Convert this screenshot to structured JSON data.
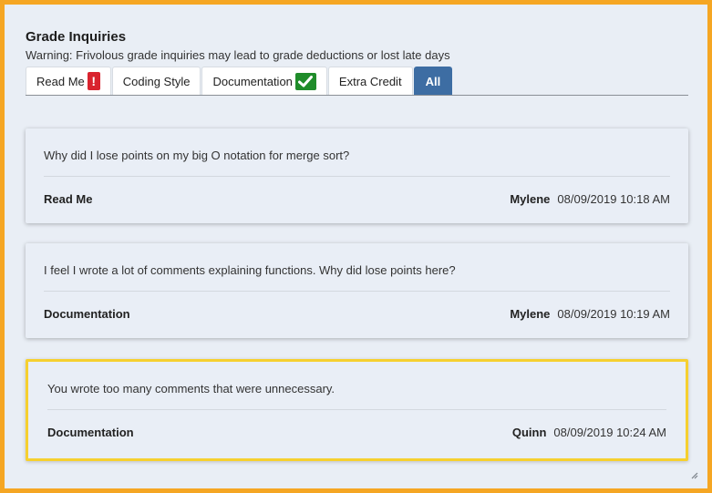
{
  "header": {
    "title": "Grade Inquiries",
    "warning": "Warning: Frivolous grade inquiries may lead to grade deductions or lost late days"
  },
  "tabs": [
    {
      "label": "Read Me",
      "badge": "alert",
      "badge_icon": "exclamation-icon"
    },
    {
      "label": "Coding Style"
    },
    {
      "label": "Documentation",
      "badge": "ok",
      "badge_icon": "checkmark-icon"
    },
    {
      "label": "Extra Credit"
    },
    {
      "label": "All",
      "active": true
    }
  ],
  "inquiries": [
    {
      "question": "Why did I lose points on my big O notation for merge sort?",
      "category": "Read Me",
      "author": "Mylene",
      "timestamp": "08/09/2019 10:18 AM"
    },
    {
      "question": "I feel I wrote a lot of comments explaining functions. Why did lose points here?",
      "category": "Documentation",
      "author": "Mylene",
      "timestamp": "08/09/2019 10:19 AM"
    },
    {
      "question": "You wrote too many comments that were unnecessary.",
      "category": "Documentation",
      "author": "Quinn",
      "timestamp": "08/09/2019 10:24 AM",
      "selected": true
    }
  ],
  "colors": {
    "frame_border": "#f5a623",
    "active_tab": "#3d6da3",
    "alert_badge": "#d9232e",
    "ok_badge": "#1f8c2a",
    "selected_border": "#f6d02f"
  }
}
